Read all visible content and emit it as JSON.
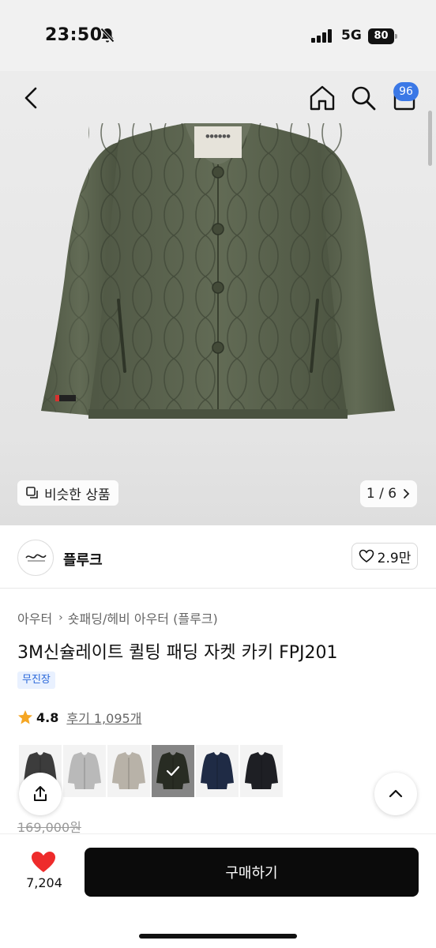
{
  "status_bar": {
    "time": "23:50",
    "network": "5G",
    "battery": "80",
    "icons": [
      "bell-slash-icon",
      "signal-icon"
    ]
  },
  "top_nav": {
    "icons": [
      "chevron-left-icon",
      "home-icon",
      "search-icon",
      "shopping-bag-icon"
    ],
    "cart_count": "96"
  },
  "gallery": {
    "similar_label": "비슷한 상품",
    "counter": "1 / 6",
    "label_tag_text": "Kakao"
  },
  "brand": {
    "name": "플루크",
    "likes": "2.9만"
  },
  "product": {
    "breadcrumb_1": "아우터",
    "breadcrumb_2": "숏패딩/헤비 아우터 (플루크)",
    "title": "3M신슐레이트 퀼팅 패딩 자켓 카키 FPJ201",
    "badge": "무진장",
    "rating": "4.8",
    "reviews": "후기 1,095개",
    "original_price": "169,000원"
  },
  "swatches": [
    {
      "color": "#3c3c3c",
      "selected": false
    },
    {
      "color": "#b9b9b9",
      "selected": false
    },
    {
      "color": "#b8b2a8",
      "selected": false
    },
    {
      "color": "#4a5040",
      "selected": true
    },
    {
      "color": "#1f2b45",
      "selected": false
    },
    {
      "color": "#1e1f24",
      "selected": false
    }
  ],
  "bottom_bar": {
    "wishlist_count": "7,204",
    "buy_label": "구매하기"
  },
  "colors": {
    "accent_blue": "#3b78e6",
    "heart_red": "#ee2b2b",
    "jacket_khaki": "#59624d"
  }
}
